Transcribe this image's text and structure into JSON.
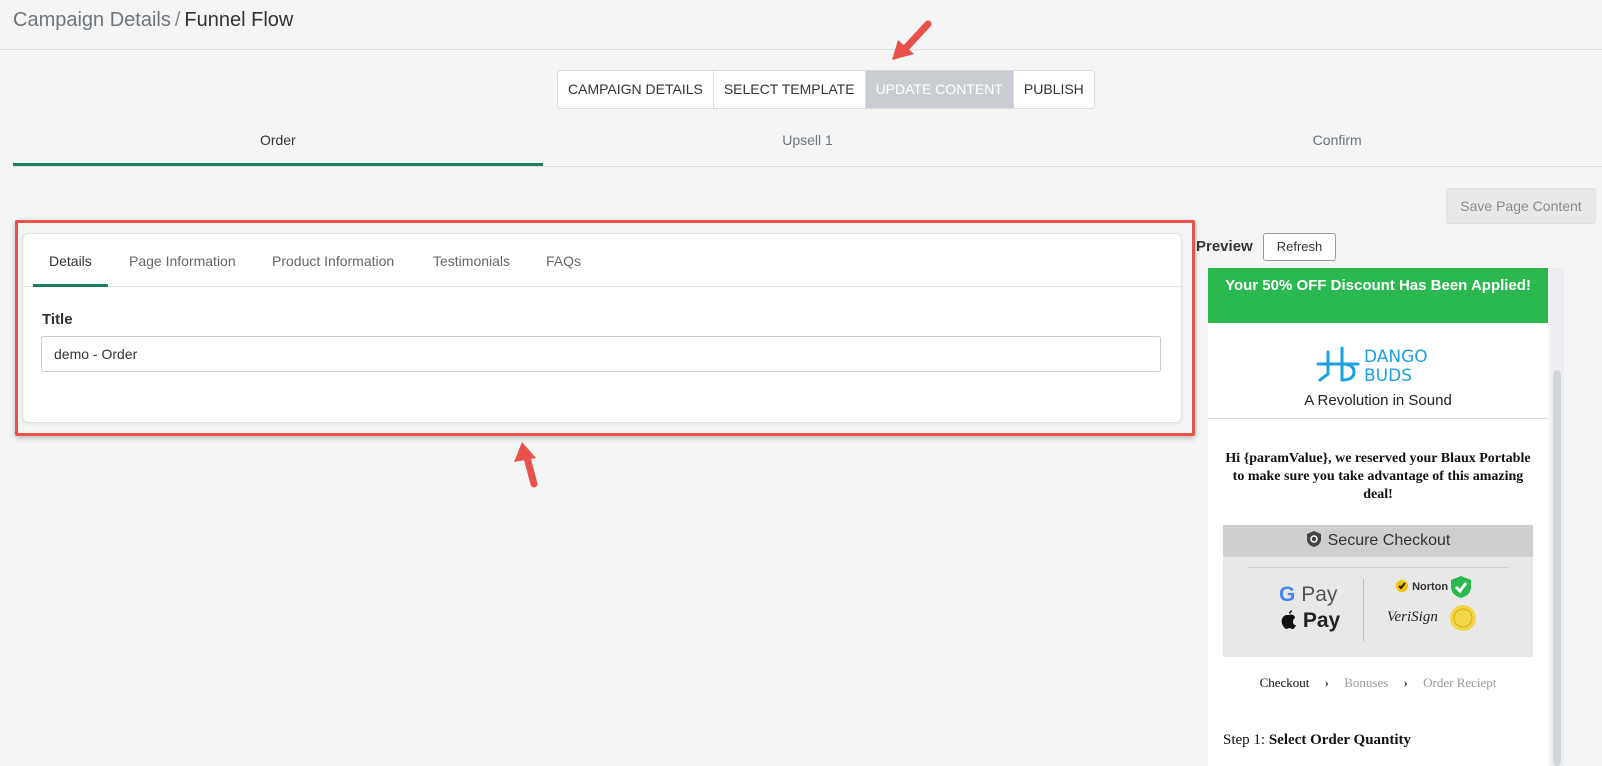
{
  "breadcrumb": {
    "parent": "Campaign Details",
    "separator": "/",
    "current": "Funnel Flow"
  },
  "steps": [
    {
      "label": "CAMPAIGN DETAILS",
      "active": false
    },
    {
      "label": "SELECT TEMPLATE",
      "active": false
    },
    {
      "label": "UPDATE CONTENT",
      "active": true
    },
    {
      "label": "PUBLISH",
      "active": false
    }
  ],
  "page_tabs": [
    {
      "label": "Order",
      "active": true
    },
    {
      "label": "Upsell 1",
      "active": false
    },
    {
      "label": "Confirm",
      "active": false
    }
  ],
  "save_button": "Save Page Content",
  "content_tabs": [
    {
      "label": "Details",
      "active": true
    },
    {
      "label": "Page Information",
      "active": false
    },
    {
      "label": "Product Information",
      "active": false
    },
    {
      "label": "Testimonials",
      "active": false
    },
    {
      "label": "FAQs",
      "active": false
    }
  ],
  "details": {
    "title_label": "Title",
    "title_value": "demo - Order"
  },
  "preview": {
    "label": "Preview",
    "refresh": "Refresh",
    "banner": "Your 50% OFF Discount Has Been Applied!",
    "logo_line1": "DANGO",
    "logo_line2": "BUDS",
    "tagline": "A Revolution in Sound",
    "greeting": "Hi {paramValue}, we reserved your Blaux Portable to make sure you take advantage of this amazing deal!",
    "secure": "Secure Checkout",
    "gpay": "Pay",
    "apay": "Pay",
    "norton": "Norton",
    "verisign": "VeriSign",
    "crumbs": [
      "Checkout",
      "Bonuses",
      "Order Reciept"
    ],
    "step_prefix": "Step 1:",
    "step_title": "Select Order Quantity"
  },
  "colors": {
    "accent": "#1a7f5a",
    "highlight": "#e9524a",
    "banner": "#2bb94f"
  },
  "icons": [
    "arrow-pointer-icon",
    "shield-icon",
    "google-g-icon",
    "apple-icon",
    "chevron-right-icon"
  ]
}
